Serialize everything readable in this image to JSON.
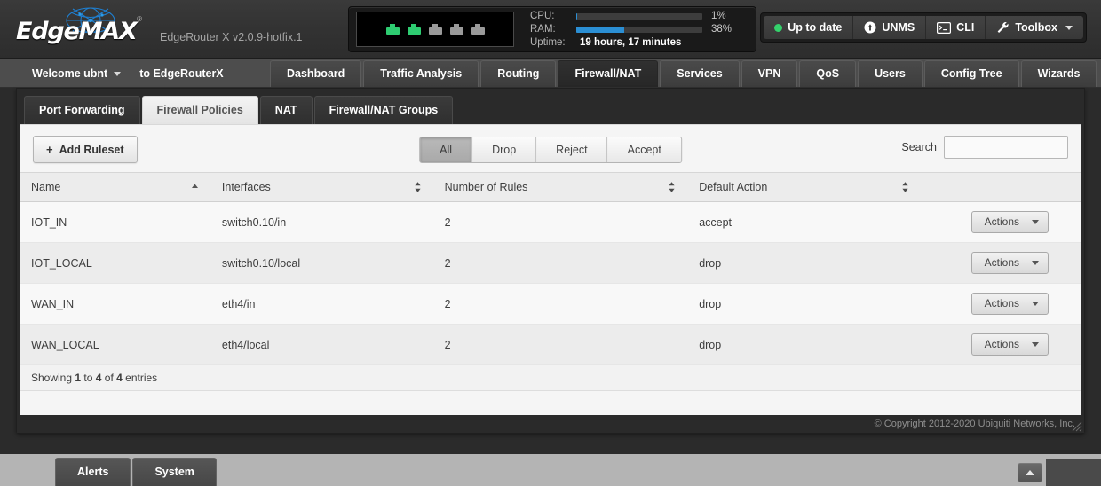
{
  "brand": {
    "logo_text_edge": "Edge",
    "logo_text_max": "MAX",
    "registered_mark": "®",
    "device_subtitle": "EdgeRouter X v2.0.9-hotfix.1"
  },
  "status_panel": {
    "ports": [
      {
        "name": "port-1",
        "state": "on"
      },
      {
        "name": "port-2",
        "state": "on"
      },
      {
        "name": "port-3",
        "state": "off"
      },
      {
        "name": "port-4",
        "state": "off"
      },
      {
        "name": "port-5",
        "state": "off"
      }
    ],
    "cpu_label": "CPU:",
    "cpu_value": "1%",
    "cpu_percent": 1,
    "ram_label": "RAM:",
    "ram_value": "38%",
    "ram_percent": 38,
    "uptime_label": "Uptime:",
    "uptime_value": "19 hours, 17 minutes",
    "bar_color": "#2b8fd4"
  },
  "top_actions": {
    "status_label": "Up to date",
    "status_color": "#34d16b",
    "unms_label": "UNMS",
    "cli_label": "CLI",
    "toolbox_label": "Toolbox"
  },
  "nav": {
    "welcome_user": "Welcome ubnt",
    "welcome_to": "to EdgeRouterX",
    "tabs": [
      {
        "label": "Dashboard",
        "active": false
      },
      {
        "label": "Traffic Analysis",
        "active": false
      },
      {
        "label": "Routing",
        "active": false
      },
      {
        "label": "Firewall/NAT",
        "active": true
      },
      {
        "label": "Services",
        "active": false
      },
      {
        "label": "VPN",
        "active": false
      },
      {
        "label": "QoS",
        "active": false
      },
      {
        "label": "Users",
        "active": false
      },
      {
        "label": "Config Tree",
        "active": false
      },
      {
        "label": "Wizards",
        "active": false
      }
    ]
  },
  "subtabs": [
    {
      "label": "Port Forwarding",
      "active": false
    },
    {
      "label": "Firewall Policies",
      "active": true
    },
    {
      "label": "NAT",
      "active": false
    },
    {
      "label": "Firewall/NAT Groups",
      "active": false
    }
  ],
  "toolbar": {
    "add_ruleset_label": "Add Ruleset",
    "plus_glyph": "+",
    "filters": [
      {
        "label": "All",
        "active": true
      },
      {
        "label": "Drop",
        "active": false
      },
      {
        "label": "Reject",
        "active": false
      },
      {
        "label": "Accept",
        "active": false
      }
    ],
    "search_label": "Search",
    "search_value": "",
    "search_placeholder": ""
  },
  "table": {
    "columns": [
      {
        "label": "Name",
        "sort": "asc"
      },
      {
        "label": "Interfaces",
        "sort": "none"
      },
      {
        "label": "Number of Rules",
        "sort": "none"
      },
      {
        "label": "Default Action",
        "sort": "none"
      },
      {
        "label": "",
        "sort": null
      }
    ],
    "rows": [
      {
        "name": "IOT_IN",
        "interfaces": "switch0.10/in",
        "rules": "2",
        "default_action": "accept",
        "actions_label": "Actions"
      },
      {
        "name": "IOT_LOCAL",
        "interfaces": "switch0.10/local",
        "rules": "2",
        "default_action": "drop",
        "actions_label": "Actions"
      },
      {
        "name": "WAN_IN",
        "interfaces": "eth4/in",
        "rules": "2",
        "default_action": "drop",
        "actions_label": "Actions"
      },
      {
        "name": "WAN_LOCAL",
        "interfaces": "eth4/local",
        "rules": "2",
        "default_action": "drop",
        "actions_label": "Actions"
      }
    ],
    "showing_prefix": "Showing ",
    "showing_from": "1",
    "showing_mid": " to ",
    "showing_to": "4",
    "showing_mid2": " of ",
    "showing_total": "4",
    "showing_suffix": " entries"
  },
  "footer": {
    "copyright": "© Copyright 2012-2020 Ubiquiti Networks, Inc."
  },
  "bottombar": {
    "tabs": [
      {
        "label": "Alerts"
      },
      {
        "label": "System"
      }
    ]
  }
}
